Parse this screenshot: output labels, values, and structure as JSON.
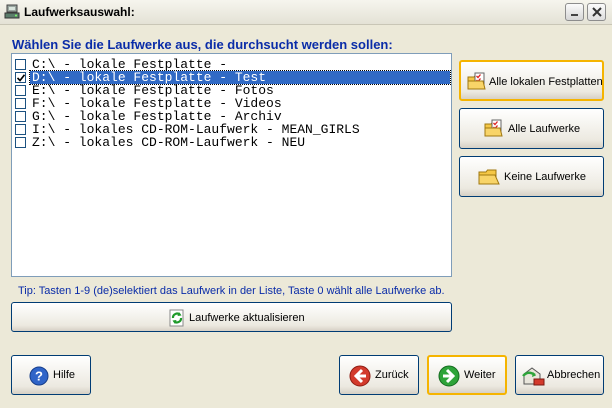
{
  "window": {
    "title": "Laufwerksauswahl:",
    "icon": "app-drive-icon"
  },
  "main": {
    "instruction": "Wählen Sie die Laufwerke aus, die durchsucht werden sollen:",
    "drives": [
      {
        "label": "C:\\ - lokale Festplatte -",
        "checked": false,
        "selected": false
      },
      {
        "label": "D:\\ - lokale Festplatte - Test",
        "checked": true,
        "selected": true
      },
      {
        "label": "E:\\ - lokale Festplatte - Fotos",
        "checked": false,
        "selected": false
      },
      {
        "label": "F:\\ - lokale Festplatte - Videos",
        "checked": false,
        "selected": false
      },
      {
        "label": "G:\\ - lokale Festplatte - Archiv",
        "checked": false,
        "selected": false
      },
      {
        "label": "I:\\ - lokales CD-ROM-Laufwerk - MEAN_GIRLS",
        "checked": false,
        "selected": false
      },
      {
        "label": "Z:\\ - lokales CD-ROM-Laufwerk - NEU",
        "checked": false,
        "selected": false
      }
    ],
    "tip": "Tip: Tasten 1-9 (de)selektiert das Laufwerk in der Liste, Taste 0 wählt alle Laufwerke ab.",
    "refresh_label": "Laufwerke aktualisieren"
  },
  "side": {
    "all_local_label": "Alle lokalen Festplatten",
    "all_label": "Alle Laufwerke",
    "none_label": "Keine Laufwerke"
  },
  "footer": {
    "help_label": "Hilfe",
    "back_label": "Zurück",
    "next_label": "Weiter",
    "cancel_label": "Abbrechen"
  },
  "colors": {
    "accent_blue": "#0a2ca8",
    "selection": "#316ac5",
    "focus_ring": "#f5b400",
    "background": "#ece9d8"
  }
}
